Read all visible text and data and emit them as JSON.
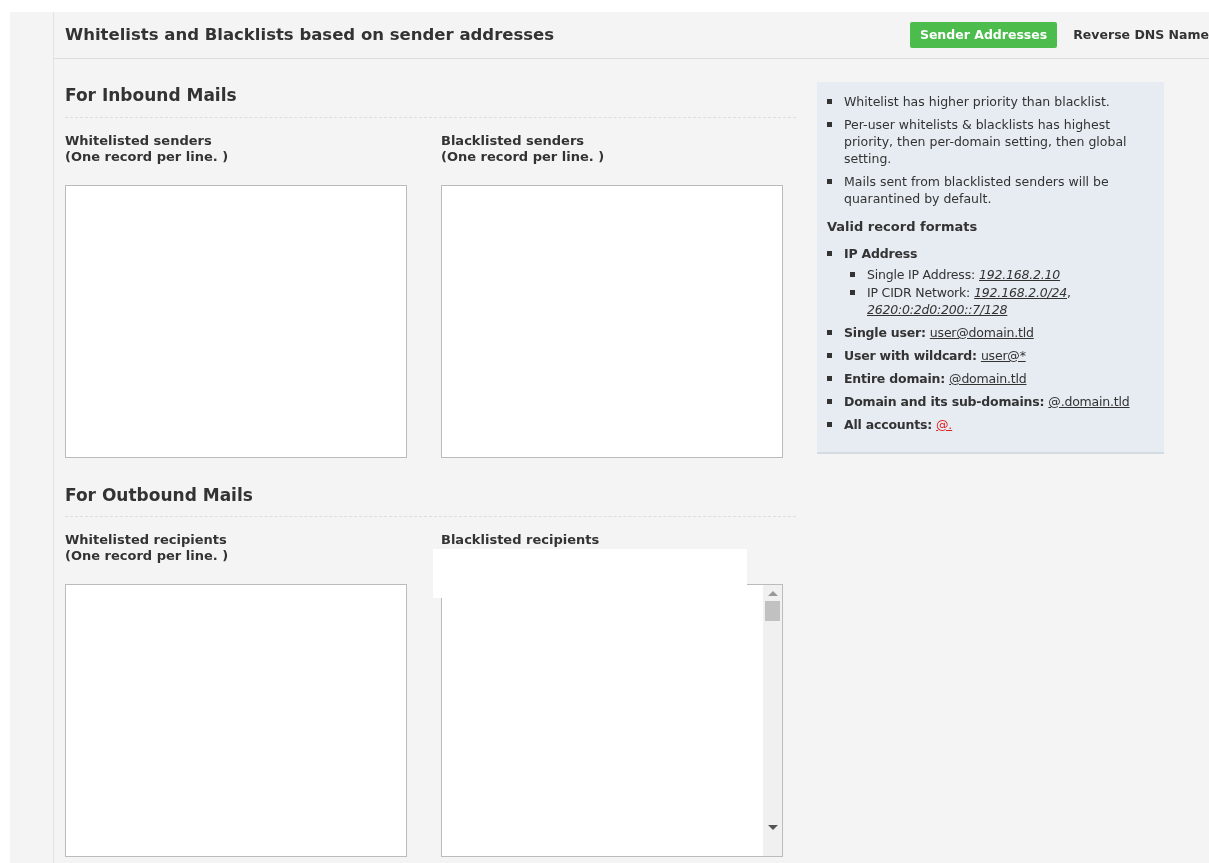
{
  "header": {
    "title": "Whitelists and Blacklists based on sender addresses",
    "tabs": [
      {
        "label": "Sender Addresses",
        "selected": true
      },
      {
        "label": "Reverse DNS Name",
        "selected": false
      }
    ]
  },
  "sections": [
    {
      "title": "For Inbound Mails",
      "fields": [
        {
          "label": "Whitelisted senders",
          "hint": "(One record per line. )",
          "scrollbar": false
        },
        {
          "label": "Blacklisted senders",
          "hint": "(One record per line. )",
          "scrollbar": false
        }
      ]
    },
    {
      "title": "For Outbound Mails",
      "fields": [
        {
          "label": "Whitelisted recipients",
          "hint": "(One record per line. )",
          "scrollbar": false
        },
        {
          "label": "Blacklisted recipients",
          "redacted": true,
          "scrollbar": true
        }
      ]
    }
  ],
  "info": {
    "notes": [
      "Whitelist has higher priority than blacklist.",
      "Per-user whitelists & blacklists has highest priority, then per-domain setting, then global setting.",
      "Mails sent from blacklisted senders will be quarantined by default."
    ],
    "formats_title": "Valid record formats",
    "formats": [
      {
        "label": "IP Address",
        "children": [
          {
            "label": "Single IP Address:",
            "links": [
              {
                "text": "192.168.2.10",
                "kind": "italic"
              }
            ]
          },
          {
            "label": "IP CIDR Network:",
            "separator": ",",
            "links": [
              {
                "text": "192.168.2.0/24",
                "kind": "italic"
              },
              {
                "text": "2620:0:2d0:200::7/128",
                "kind": "italic"
              }
            ]
          }
        ]
      },
      {
        "label": "Single user:",
        "links": [
          {
            "text": "user@domain.tld",
            "kind": "plain"
          }
        ]
      },
      {
        "label": "User with wildcard:",
        "links": [
          {
            "text": "user@*",
            "kind": "plain"
          }
        ]
      },
      {
        "label": "Entire domain:",
        "links": [
          {
            "text": "@domain.tld",
            "kind": "plain"
          }
        ]
      },
      {
        "label": "Domain and its sub-domains:",
        "links": [
          {
            "text": "@.domain.tld",
            "kind": "plain"
          }
        ]
      },
      {
        "label": "All accounts:",
        "links": [
          {
            "text": "@.",
            "kind": "warning"
          }
        ]
      }
    ]
  }
}
